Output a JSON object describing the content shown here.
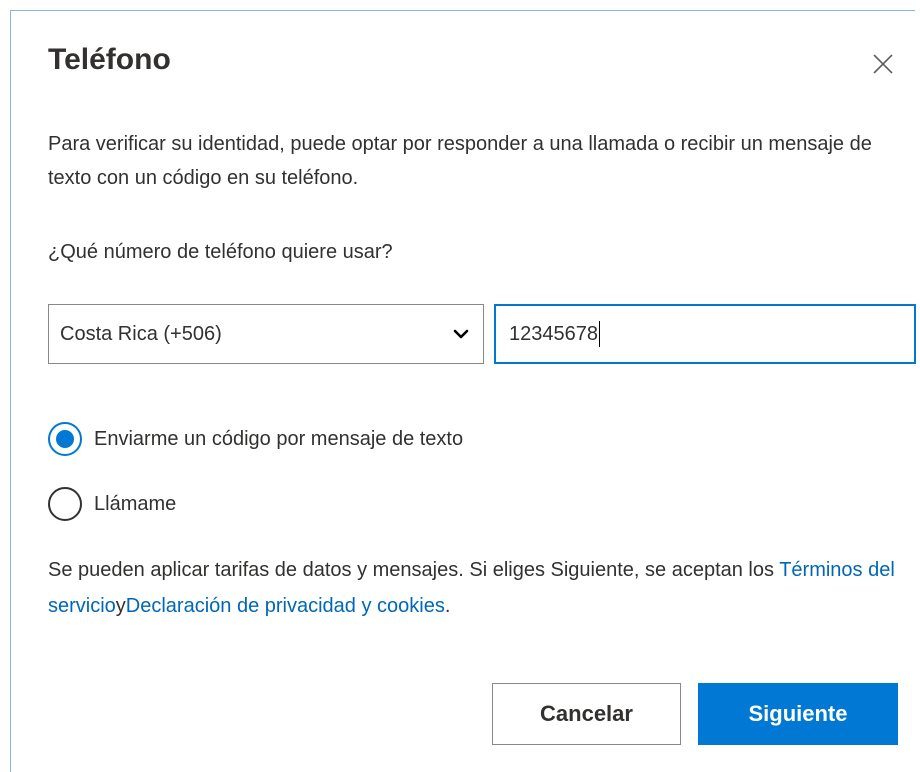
{
  "dialog": {
    "title": "Teléfono",
    "close_icon": "close-icon",
    "description": "Para verificar su identidad, puede optar por responder a una llamada o recibir un mensaje de texto con un código en su teléfono.",
    "question": "¿Qué número de teléfono quiere usar?",
    "country_select": {
      "selected": "Costa Rica (+506)",
      "icon": "chevron-down-icon"
    },
    "phone_input": {
      "value": "12345678"
    },
    "options": [
      {
        "label": "Enviarme un código por mensaje de texto",
        "checked": true
      },
      {
        "label": "Llámame",
        "checked": false
      }
    ],
    "terms": {
      "text_before": "Se pueden aplicar tarifas de datos y mensajes. Si eliges Siguiente, se aceptan los ",
      "terms_link": "Términos del servicio",
      "joiner": "y",
      "privacy_link": "Declaración de privacidad y cookies",
      "text_after": "."
    },
    "buttons": {
      "cancel": "Cancelar",
      "next": "Siguiente"
    }
  },
  "colors": {
    "accent": "#0078d4",
    "link": "#0067b8",
    "text": "#323130"
  }
}
